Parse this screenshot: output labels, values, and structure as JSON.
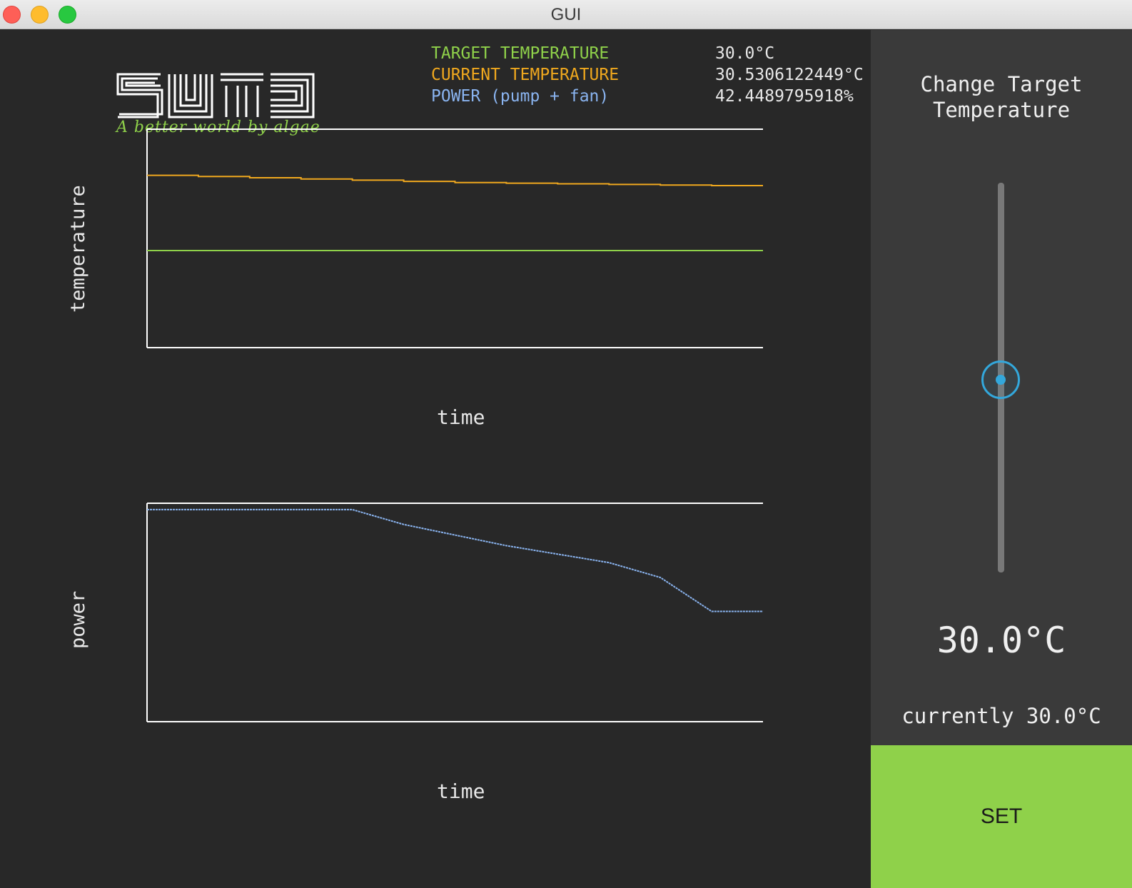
{
  "window": {
    "title": "GUI"
  },
  "logo": {
    "text": "SUTD",
    "tagline": "A better world by algae"
  },
  "legend": {
    "target": {
      "label": "TARGET TEMPERATURE",
      "value": "30.0°C",
      "color": "#8fd14a"
    },
    "current": {
      "label": "CURRENT TEMPERATURE",
      "value": "30.5306122449°C",
      "color": "#f0a81e"
    },
    "power": {
      "label": "POWER (pump + fan)",
      "value": "42.4489795918%",
      "color": "#8ab4f0"
    }
  },
  "chart_data": [
    {
      "type": "line",
      "xlabel": "time",
      "ylabel": "temperature",
      "grid": false,
      "series": [
        {
          "color": "#f0a81e",
          "values": [
            30.62,
            30.61,
            30.6,
            30.59,
            30.58,
            30.57,
            30.56,
            30.555,
            30.55,
            30.545,
            30.54,
            30.535
          ]
        },
        {
          "color": "#8fd14a",
          "values": [
            30.0,
            30.0,
            30.0,
            30.0,
            30.0,
            30.0,
            30.0,
            30.0,
            30.0,
            30.0,
            30.0,
            30.0
          ]
        }
      ]
    },
    {
      "type": "line",
      "xlabel": "time",
      "ylabel": "power",
      "grid": false,
      "series": [
        {
          "color": "#8ab4f0",
          "values": [
            100,
            100,
            100,
            100,
            100,
            93,
            88,
            83,
            79,
            75,
            68,
            52
          ]
        }
      ]
    }
  ],
  "sidebar": {
    "title_line1": "Change Target",
    "title_line2": "Temperature",
    "slider_value": 30.0,
    "slider_fraction": 0.5,
    "display_value": "30.0°C",
    "current_text": "currently 30.0°C",
    "accent_color": "#33a8dc",
    "set_label": "SET",
    "set_color": "#8fd14a"
  }
}
